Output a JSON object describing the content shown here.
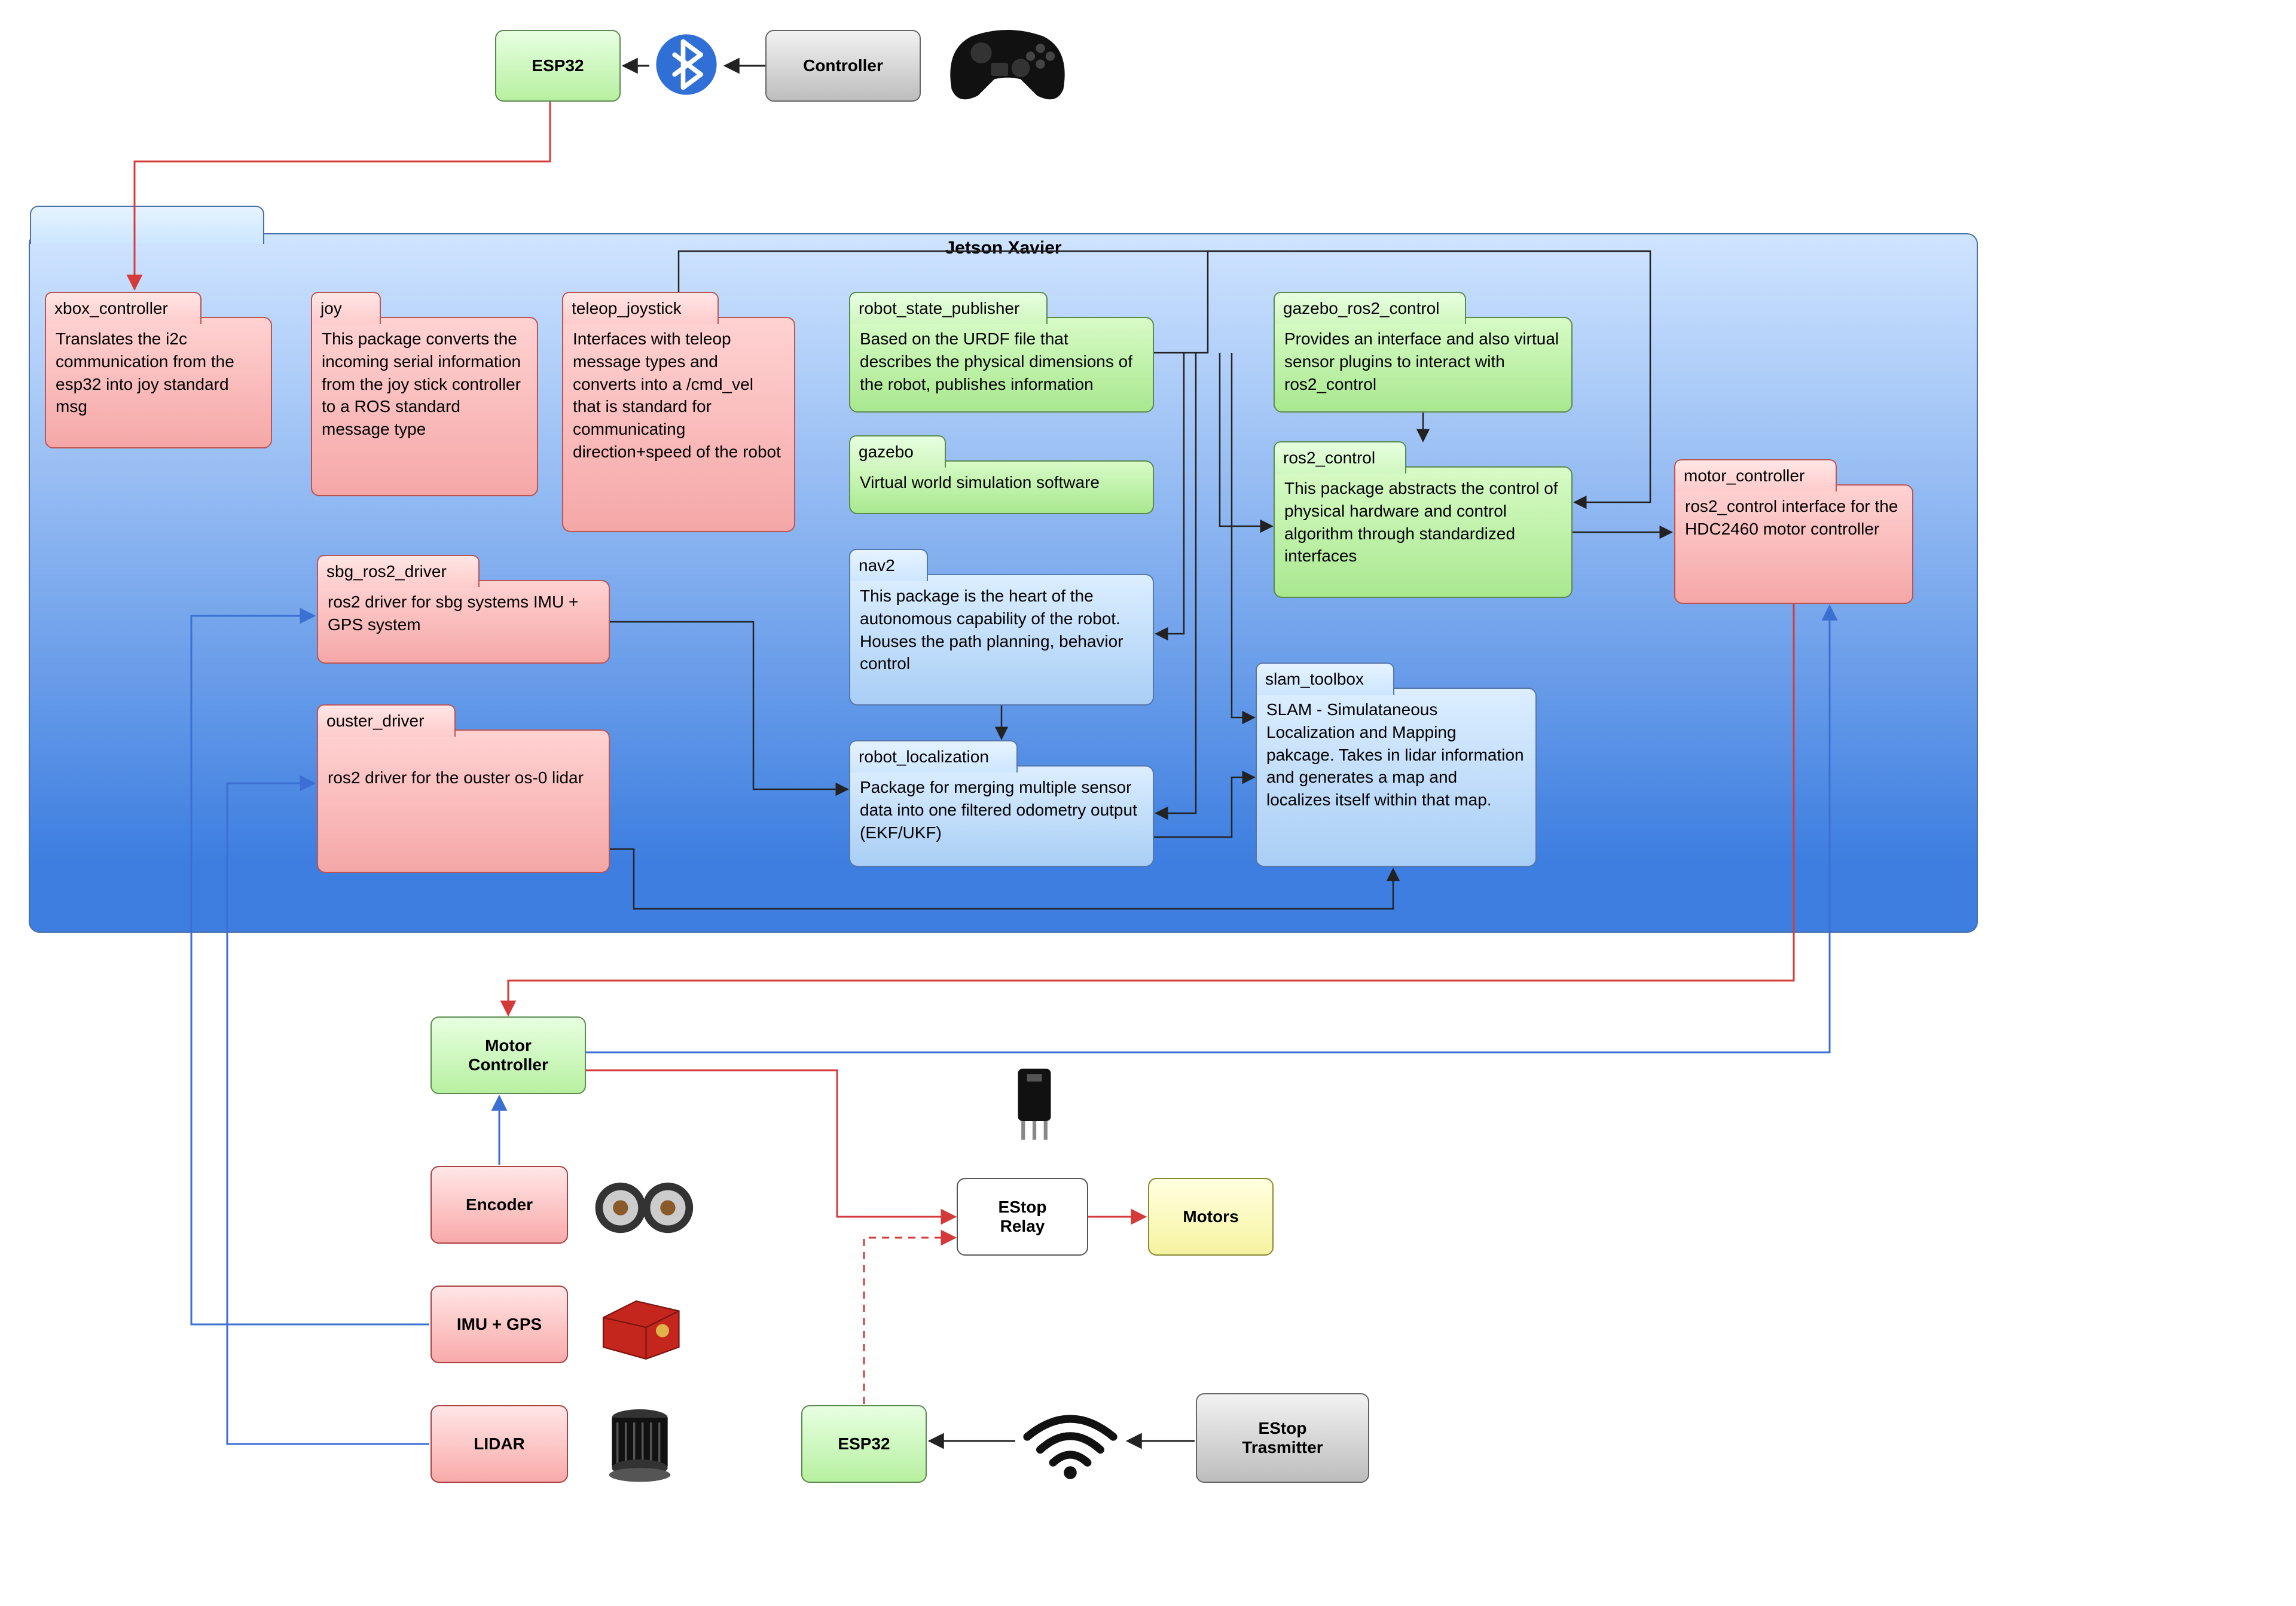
{
  "top": {
    "esp32": "ESP32",
    "controller": "Controller"
  },
  "jetson": {
    "title": "Jetson Xavier",
    "xbox_controller": {
      "title": "xbox_controller",
      "body": "Translates the i2c communication from the esp32 into joy standard msg"
    },
    "joy": {
      "title": "joy",
      "body": "This package converts the incoming serial information from the joy stick controller to a ROS standard message type"
    },
    "teleop_joystick": {
      "title": "teleop_joystick",
      "body": "Interfaces with teleop message types and converts into a /cmd_vel that is standard for communicating direction+speed of the robot"
    },
    "robot_state_publisher": {
      "title": "robot_state_publisher",
      "body": "Based on the URDF file that describes the physical dimensions of the robot, publishes information"
    },
    "gazebo": {
      "title": "gazebo",
      "body": "Virtual world simulation software"
    },
    "gazebo_ros2_control": {
      "title": "gazebo_ros2_control",
      "body": "Provides an interface and also virtual sensor plugins to interact with ros2_control"
    },
    "ros2_control": {
      "title": "ros2_control",
      "body": "This package abstracts the control of physical hardware and control algorithm through standardized interfaces"
    },
    "motor_controller": {
      "title": "motor_controller",
      "body": "ros2_control interface for the HDC2460 motor controller"
    },
    "sbg_ros2_driver": {
      "title": "sbg_ros2_driver",
      "body": "ros2 driver for sbg systems IMU + GPS system"
    },
    "ouster_driver": {
      "title": "ouster_driver",
      "body": "ros2 driver for the ouster os-0 lidar"
    },
    "nav2": {
      "title": "nav2",
      "body": "This package is the heart of the autonomous capability of the robot. Houses the path planning, behavior control"
    },
    "robot_localization": {
      "title": "robot_localization",
      "body": "Package for merging multiple sensor data into one filtered odometry output (EKF/UKF)"
    },
    "slam_toolbox": {
      "title": "slam_toolbox",
      "body": "SLAM - Simulataneous Localization and Mapping pakcage. Takes in lidar information and generates a map and localizes itself within that map."
    }
  },
  "bottom": {
    "motor_controller": "Motor\nController",
    "encoder": "Encoder",
    "imu_gps": "IMU + GPS",
    "lidar": "LIDAR",
    "estop_relay": "EStop\nRelay",
    "motors": "Motors",
    "esp32": "ESP32",
    "estop_tx": "EStop\nTrasmitter"
  },
  "icons": {
    "bluetooth": "bluetooth-icon",
    "gamepad": "gamepad-icon",
    "relay": "relay-icon",
    "encoder_pair": "encoder-icon",
    "imu_box": "imu-icon",
    "lidar": "lidar-icon",
    "wifi": "wifi-icon"
  },
  "colors": {
    "arrow_red": "#d43a3a",
    "arrow_black": "#222222",
    "arrow_blue": "#3b6fd1"
  }
}
